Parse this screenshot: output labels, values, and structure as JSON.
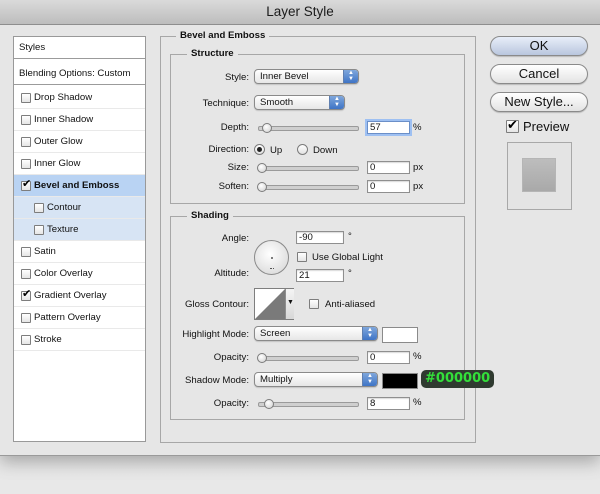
{
  "window": {
    "title": "Layer Style"
  },
  "sidebar": {
    "header": "Styles",
    "blending": "Blending Options: Custom",
    "items": [
      {
        "label": "Drop Shadow",
        "checked": false,
        "selected": false,
        "sub": false
      },
      {
        "label": "Inner Shadow",
        "checked": false,
        "selected": false,
        "sub": false
      },
      {
        "label": "Outer Glow",
        "checked": false,
        "selected": false,
        "sub": false
      },
      {
        "label": "Inner Glow",
        "checked": false,
        "selected": false,
        "sub": false
      },
      {
        "label": "Bevel and Emboss",
        "checked": true,
        "selected": true,
        "sub": false
      },
      {
        "label": "Contour",
        "checked": false,
        "selected": false,
        "sub": true
      },
      {
        "label": "Texture",
        "checked": false,
        "selected": false,
        "sub": true
      },
      {
        "label": "Satin",
        "checked": false,
        "selected": false,
        "sub": false
      },
      {
        "label": "Color Overlay",
        "checked": false,
        "selected": false,
        "sub": false
      },
      {
        "label": "Gradient Overlay",
        "checked": true,
        "selected": false,
        "sub": false
      },
      {
        "label": "Pattern Overlay",
        "checked": false,
        "selected": false,
        "sub": false
      },
      {
        "label": "Stroke",
        "checked": false,
        "selected": false,
        "sub": false
      }
    ]
  },
  "main": {
    "title": "Bevel and Emboss",
    "structure": {
      "title": "Structure",
      "style_label": "Style:",
      "style_value": "Inner Bevel",
      "technique_label": "Technique:",
      "technique_value": "Smooth",
      "depth_label": "Depth:",
      "depth_value": "57",
      "depth_unit": "%",
      "depth_level": 0.06,
      "direction_label": "Direction:",
      "direction_up": "Up",
      "direction_down": "Down",
      "direction_selected": "Up",
      "size_label": "Size:",
      "size_value": "0",
      "size_unit": "px",
      "size_level": 0.0,
      "soften_label": "Soften:",
      "soften_value": "0",
      "soften_unit": "px",
      "soften_level": 0.0
    },
    "shading": {
      "title": "Shading",
      "angle_label": "Angle:",
      "angle_value": "-90",
      "angle_unit": "°",
      "global_light_label": "Use Global Light",
      "global_light_checked": false,
      "altitude_label": "Altitude:",
      "altitude_value": "21",
      "altitude_unit": "°",
      "gloss_label": "Gloss Contour:",
      "antialiased_label": "Anti-aliased",
      "antialiased_checked": false,
      "highlight_mode_label": "Highlight Mode:",
      "highlight_mode_value": "Screen",
      "highlight_color": "#ffffff",
      "highlight_opacity_label": "Opacity:",
      "highlight_opacity_value": "0",
      "highlight_opacity_unit": "%",
      "highlight_opacity_level": 0.0,
      "shadow_mode_label": "Shadow Mode:",
      "shadow_mode_value": "Multiply",
      "shadow_color": "#000000",
      "shadow_color_tag": "#000000",
      "shadow_opacity_label": "Opacity:",
      "shadow_opacity_value": "8",
      "shadow_opacity_unit": "%",
      "shadow_opacity_level": 0.08
    }
  },
  "buttons": {
    "ok": "OK",
    "cancel": "Cancel",
    "new_style": "New Style...",
    "preview": "Preview",
    "preview_checked": true
  },
  "colors": {
    "tag_bg": "#2f3a30",
    "tag_text": "#33e03a",
    "selection": "#b9d3f3"
  }
}
